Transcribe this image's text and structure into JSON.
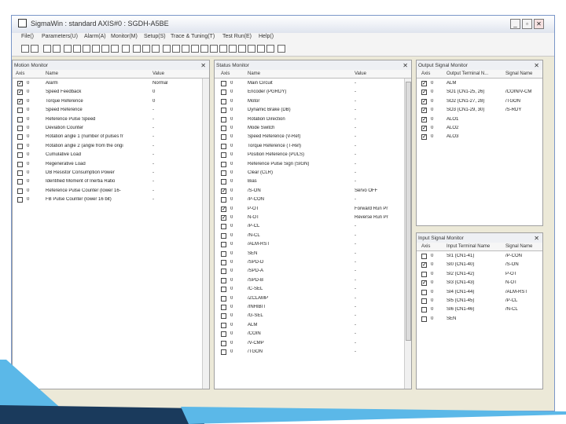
{
  "window": {
    "title": "SigmaWin : standard AXIS#0 : SGDH-A5BE",
    "minimize": "_",
    "restore": "▫",
    "close": "✕"
  },
  "menu": [
    "File()",
    "Parameters(U)",
    "Alarm(A)",
    "Monitor(M)",
    "Setup(S)",
    "Trace & Tuning(T)",
    "Test Run(E)",
    "Help()"
  ],
  "motion_monitor": {
    "title": "Motion Monitor",
    "columns": [
      "Axis",
      "Name",
      "Value"
    ],
    "rows": [
      {
        "checked": true,
        "axis": "0",
        "name": "Alarm",
        "value": "Normal"
      },
      {
        "checked": true,
        "axis": "0",
        "name": "Speed Feedback",
        "value": "0"
      },
      {
        "checked": true,
        "axis": "0",
        "name": "Torque Reference",
        "value": "0"
      },
      {
        "checked": false,
        "axis": "0",
        "name": "Speed Reference",
        "value": "-"
      },
      {
        "checked": false,
        "axis": "0",
        "name": "Reference Pulse Speed",
        "value": "-"
      },
      {
        "checked": false,
        "axis": "0",
        "name": "Deviation Counter",
        "value": "-"
      },
      {
        "checked": false,
        "axis": "0",
        "name": "Rotation angle 1 (number of pulses fr",
        "value": "-"
      },
      {
        "checked": false,
        "axis": "0",
        "name": "Rotation angle 2 (angle from the origi",
        "value": "-"
      },
      {
        "checked": false,
        "axis": "0",
        "name": "Cumulative Load",
        "value": "-"
      },
      {
        "checked": false,
        "axis": "0",
        "name": "Regenerative Load",
        "value": "-"
      },
      {
        "checked": false,
        "axis": "0",
        "name": "DB Resistor Consumption Power",
        "value": "-"
      },
      {
        "checked": false,
        "axis": "0",
        "name": "Identified Moment of Inertia Ratio",
        "value": "-"
      },
      {
        "checked": false,
        "axis": "0",
        "name": "Reference Pulse Counter (lower 16-",
        "value": "-"
      },
      {
        "checked": false,
        "axis": "0",
        "name": "FB Pulse Counter (lower 16 bit)",
        "value": "-"
      }
    ]
  },
  "status_monitor": {
    "title": "Status Monitor",
    "columns": [
      "Axis",
      "Name",
      "Value"
    ],
    "rows": [
      {
        "checked": false,
        "axis": "0",
        "name": "Main Circuit",
        "value": "-"
      },
      {
        "checked": false,
        "axis": "0",
        "name": "Encoder (PGRDY)",
        "value": "-"
      },
      {
        "checked": false,
        "axis": "0",
        "name": "Motor",
        "value": "-"
      },
      {
        "checked": false,
        "axis": "0",
        "name": "Dynamic Brake (DB)",
        "value": "-"
      },
      {
        "checked": false,
        "axis": "0",
        "name": "Rotation Direction",
        "value": "-"
      },
      {
        "checked": false,
        "axis": "0",
        "name": "Mode Switch",
        "value": "-"
      },
      {
        "checked": false,
        "axis": "0",
        "name": "Speed Reference (V-Ref)",
        "value": "-"
      },
      {
        "checked": false,
        "axis": "0",
        "name": "Torque Reference (T-Ref)",
        "value": "-"
      },
      {
        "checked": false,
        "axis": "0",
        "name": "Position Reference (PULS)",
        "value": "-"
      },
      {
        "checked": false,
        "axis": "0",
        "name": "Reference Pulse Sign (SIGN)",
        "value": "-"
      },
      {
        "checked": false,
        "axis": "0",
        "name": "Clear (CLR)",
        "value": "-"
      },
      {
        "checked": false,
        "axis": "0",
        "name": "Bias",
        "value": "-"
      },
      {
        "checked": true,
        "axis": "0",
        "name": "/S-ON",
        "value": "Servo OFF"
      },
      {
        "checked": false,
        "axis": "0",
        "name": "/P-CON",
        "value": "-"
      },
      {
        "checked": true,
        "axis": "0",
        "name": "P-OT",
        "value": "Forward Run Pr"
      },
      {
        "checked": true,
        "axis": "0",
        "name": "N-OT",
        "value": "Reverse Run Pr"
      },
      {
        "checked": false,
        "axis": "0",
        "name": "/P-CL",
        "value": "-"
      },
      {
        "checked": false,
        "axis": "0",
        "name": "/N-CL",
        "value": "-"
      },
      {
        "checked": false,
        "axis": "0",
        "name": "/ALM-RST",
        "value": "-"
      },
      {
        "checked": false,
        "axis": "0",
        "name": "SEN",
        "value": "-"
      },
      {
        "checked": false,
        "axis": "0",
        "name": "/SPD-D",
        "value": "-"
      },
      {
        "checked": false,
        "axis": "0",
        "name": "/SPD-A",
        "value": "-"
      },
      {
        "checked": false,
        "axis": "0",
        "name": "/SPD-B",
        "value": "-"
      },
      {
        "checked": false,
        "axis": "0",
        "name": "/C-SEL",
        "value": "-"
      },
      {
        "checked": false,
        "axis": "0",
        "name": "/ZCLAMP",
        "value": "-"
      },
      {
        "checked": false,
        "axis": "0",
        "name": "/INHIBIT",
        "value": "-"
      },
      {
        "checked": false,
        "axis": "0",
        "name": "/G-SEL",
        "value": "-"
      },
      {
        "checked": false,
        "axis": "0",
        "name": "ALM",
        "value": "-"
      },
      {
        "checked": false,
        "axis": "0",
        "name": "/COIN",
        "value": "-"
      },
      {
        "checked": false,
        "axis": "0",
        "name": "/V-CMP",
        "value": "-"
      },
      {
        "checked": false,
        "axis": "0",
        "name": "/TGON",
        "value": "-"
      }
    ]
  },
  "output_monitor": {
    "title": "Output Signal Monitor",
    "columns": [
      "Axis",
      "Output Terminal N...",
      "Signal Name"
    ],
    "rows": [
      {
        "checked": true,
        "axis": "0",
        "terminal": "ALM",
        "signal": ""
      },
      {
        "checked": true,
        "axis": "0",
        "terminal": "SO1 (CN1-25, 26)",
        "signal": "/COIN/V-CM"
      },
      {
        "checked": true,
        "axis": "0",
        "terminal": "SO2 (CN1-27, 28)",
        "signal": "/TGON"
      },
      {
        "checked": true,
        "axis": "0",
        "terminal": "SO3 (CN1-29, 30)",
        "signal": "/S-RDY"
      },
      {
        "checked": true,
        "axis": "0",
        "terminal": "ALO1",
        "signal": ""
      },
      {
        "checked": true,
        "axis": "0",
        "terminal": "ALO2",
        "signal": ""
      },
      {
        "checked": true,
        "axis": "0",
        "terminal": "ALO3",
        "signal": ""
      }
    ]
  },
  "input_monitor": {
    "title": "Input Signal Monitor",
    "columns": [
      "Axis",
      "Input Terminal Name",
      "Signal Name"
    ],
    "rows": [
      {
        "checked": false,
        "axis": "0",
        "terminal": "SI1 (CN1-41)",
        "signal": "/P-CON"
      },
      {
        "checked": true,
        "axis": "0",
        "terminal": "SI0 (CN1-40)",
        "signal": "/S-ON"
      },
      {
        "checked": false,
        "axis": "0",
        "terminal": "SI2 (CN1-42)",
        "signal": "P-OT"
      },
      {
        "checked": true,
        "axis": "0",
        "terminal": "SI3 (CN1-43)",
        "signal": "N-OT"
      },
      {
        "checked": false,
        "axis": "0",
        "terminal": "SI4 (CN1-44)",
        "signal": "/ALM-RST"
      },
      {
        "checked": false,
        "axis": "0",
        "terminal": "SI5 (CN1-45)",
        "signal": "/P-CL"
      },
      {
        "checked": false,
        "axis": "0",
        "terminal": "SI6 (CN1-46)",
        "signal": "/N-CL"
      },
      {
        "checked": false,
        "axis": "0",
        "terminal": "SEN",
        "signal": ""
      }
    ]
  },
  "colors": {
    "ribbon_dark": "#1a3a5c",
    "ribbon_light": "#5bb8e8"
  }
}
